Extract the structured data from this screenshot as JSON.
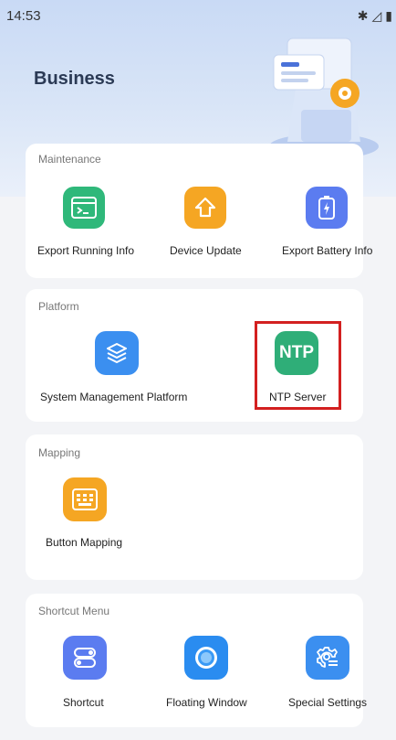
{
  "status_bar": {
    "time": "14:53",
    "icons": [
      "bluetooth-icon",
      "signal-icon",
      "battery-icon"
    ]
  },
  "page": {
    "title": "Business"
  },
  "sections": {
    "maintenance": {
      "title": "Maintenance",
      "items": [
        {
          "label": "Export Running Info",
          "icon": "terminal-icon",
          "color": "#2fb87a"
        },
        {
          "label": "Device Update",
          "icon": "upgrade-icon",
          "color": "#f5a623"
        },
        {
          "label": "Export Battery Info",
          "icon": "battery-charge-icon",
          "color": "#5b7cf0"
        }
      ]
    },
    "platform": {
      "title": "Platform",
      "items": [
        {
          "label": "System Management Platform",
          "icon": "layers-icon",
          "color": "#3b8ff0"
        },
        {
          "label": "NTP Server",
          "icon_text": "NTP",
          "icon": "ntp-icon",
          "color": "#2fae78"
        }
      ]
    },
    "mapping": {
      "title": "Mapping",
      "items": [
        {
          "label": "Button Mapping",
          "icon": "keypad-icon",
          "color": "#f5a623"
        }
      ]
    },
    "shortcut_menu": {
      "title": "Shortcut Menu",
      "items": [
        {
          "label": "Shortcut",
          "icon": "toggle-icon",
          "color": "#5b7cf0"
        },
        {
          "label": "Floating Window",
          "icon": "floating-circle-icon",
          "color": "#2a8cf0"
        },
        {
          "label": "Special Settings",
          "icon": "gear-list-icon",
          "color": "#3b8ff0"
        }
      ]
    }
  },
  "highlight_color": "#d32020"
}
